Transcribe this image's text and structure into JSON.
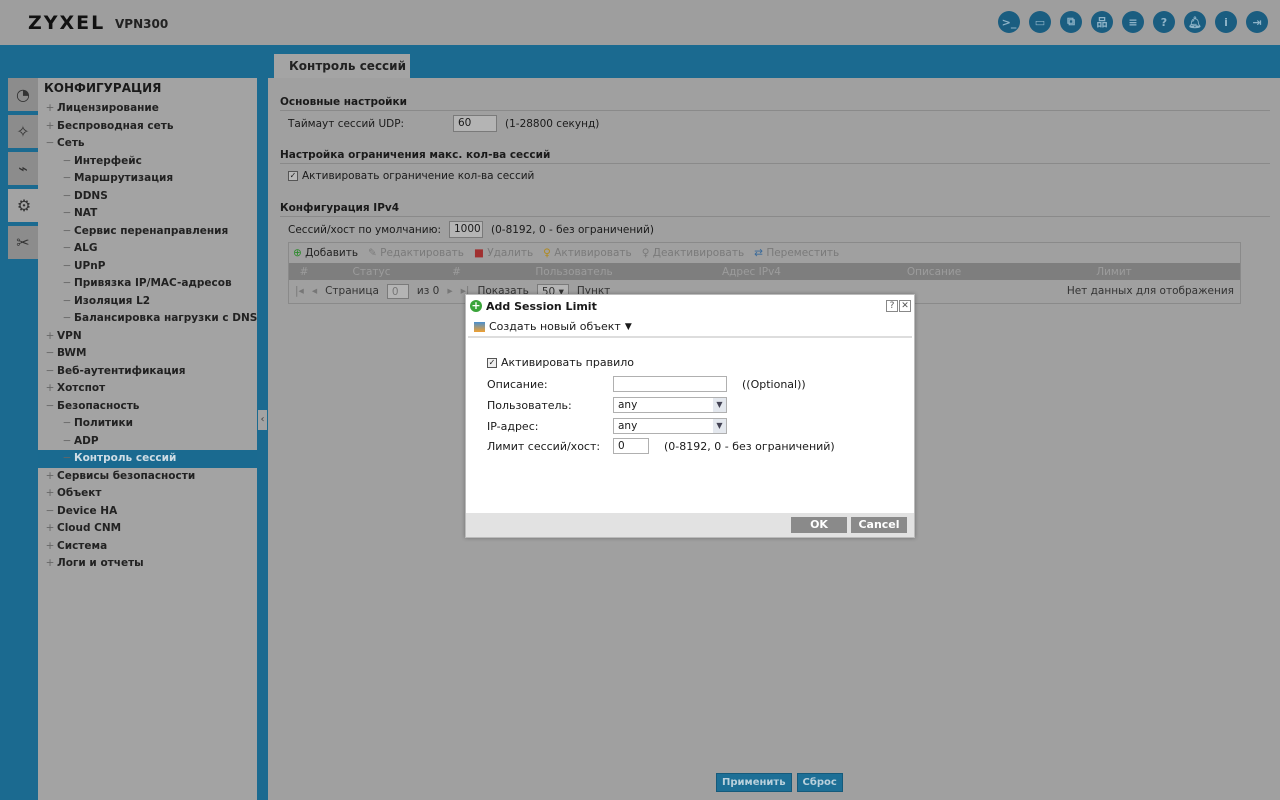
{
  "header": {
    "brand": "ZYXEL",
    "model": "VPN300",
    "icons": [
      "console-icon",
      "cli-icon",
      "window-icon",
      "network-icon",
      "chat-icon",
      "help-icon",
      "bell-icon",
      "info-icon",
      "logout-icon"
    ]
  },
  "tab": "Контроль сессий",
  "sidebar": {
    "title": "КОНФИГУРАЦИЯ",
    "items": [
      {
        "label": "Лицензирование",
        "level": 1,
        "pm": "+"
      },
      {
        "label": "Беспроводная сеть",
        "level": 1,
        "pm": "+"
      },
      {
        "label": "Сеть",
        "level": 1,
        "pm": "−"
      },
      {
        "label": "Интерфейс",
        "level": 2,
        "pm": "−"
      },
      {
        "label": "Маршрутизация",
        "level": 2,
        "pm": "−"
      },
      {
        "label": "DDNS",
        "level": 2,
        "pm": "−"
      },
      {
        "label": "NAT",
        "level": 2,
        "pm": "−"
      },
      {
        "label": "Сервис перенаправления",
        "level": 2,
        "pm": "−"
      },
      {
        "label": "ALG",
        "level": 2,
        "pm": "−"
      },
      {
        "label": "UPnP",
        "level": 2,
        "pm": "−"
      },
      {
        "label": "Привязка IP/MAC-адресов",
        "level": 2,
        "pm": "−"
      },
      {
        "label": "Изоляция L2",
        "level": 2,
        "pm": "−"
      },
      {
        "label": "Балансировка нагрузки с DNS",
        "level": 2,
        "pm": "−"
      },
      {
        "label": "VPN",
        "level": 1,
        "pm": "+"
      },
      {
        "label": "BWM",
        "level": 1,
        "pm": "−"
      },
      {
        "label": "Веб-аутентификация",
        "level": 1,
        "pm": "−"
      },
      {
        "label": "Хотспот",
        "level": 1,
        "pm": "+"
      },
      {
        "label": "Безопасность",
        "level": 1,
        "pm": "−"
      },
      {
        "label": "Политики",
        "level": 2,
        "pm": "−"
      },
      {
        "label": "ADP",
        "level": 2,
        "pm": "−"
      },
      {
        "label": "Контроль сессий",
        "level": 2,
        "pm": "−",
        "active": true
      },
      {
        "label": "Сервисы безопасности",
        "level": 1,
        "pm": "+"
      },
      {
        "label": "Объект",
        "level": 1,
        "pm": "+"
      },
      {
        "label": "Device HA",
        "level": 1,
        "pm": "−"
      },
      {
        "label": "Cloud CNM",
        "level": 1,
        "pm": "+"
      },
      {
        "label": "Система",
        "level": 1,
        "pm": "+"
      },
      {
        "label": "Логи и отчеты",
        "level": 1,
        "pm": "+"
      }
    ]
  },
  "main": {
    "basic": {
      "title": "Основные настройки",
      "udp_label": "Таймаут сессий UDP:",
      "udp_value": "60",
      "udp_hint": "(1-28800 секунд)"
    },
    "limit": {
      "title": "Настройка ограничения макс. кол-ва сессий",
      "enable_label": "Активировать ограничение кол-ва сессий",
      "enabled": true
    },
    "ipv4": {
      "title": "Конфигурация IPv4",
      "default_label": "Сессий/хост по умолчанию:",
      "default_value": "1000",
      "default_hint": "(0-8192, 0 - без ограничений)"
    },
    "toolbar": {
      "add": "Добавить",
      "edit": "Редактировать",
      "delete": "Удалить",
      "activate": "Активировать",
      "deactivate": "Деактивировать",
      "move": "Переместить"
    },
    "columns": [
      "#",
      "Статус",
      "#",
      "Пользователь",
      "Адрес IPv4",
      "Описание",
      "Лимит"
    ],
    "pager": {
      "page_label": "Страница",
      "page_value": "0",
      "of": "из 0",
      "show": "Показать",
      "per_page": "50",
      "items": "Пункт",
      "no_data": "Нет данных для отображения"
    },
    "apply": "Применить",
    "reset": "Сброс"
  },
  "dialog": {
    "title": "Add Session Limit",
    "create_object": "Создать новый объект",
    "enable_rule": "Активировать правило",
    "enabled": true,
    "desc_label": "Описание:",
    "desc_value": "",
    "desc_hint": "((Optional))",
    "user_label": "Пользователь:",
    "user_value": "any",
    "ip_label": "IP-адрес:",
    "ip_value": "any",
    "limit_label": "Лимит сессий/хост:",
    "limit_value": "0",
    "limit_hint": "(0-8192, 0 - без ограничений)",
    "ok": "OK",
    "cancel": "Cancel"
  }
}
